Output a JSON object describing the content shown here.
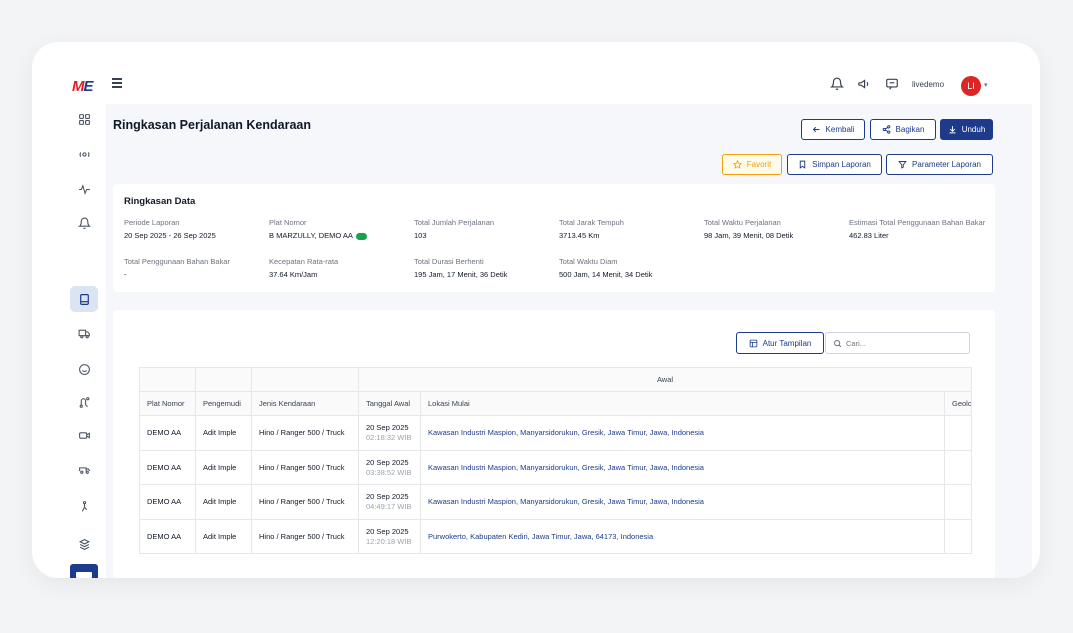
{
  "app": {
    "logo_m": "M",
    "logo_e": "E",
    "username": "livedemo",
    "avatar_initials": "LI"
  },
  "icons": {
    "top": [
      "bell-icon",
      "megaphone-icon",
      "chat-icon"
    ],
    "sidebar": [
      "dashboard-icon",
      "tracking-icon",
      "activity-icon",
      "notification-icon",
      "report-icon",
      "vehicle-icon",
      "driver-icon",
      "route-icon",
      "camera-icon",
      "fleet-icon",
      "maintenance-icon",
      "inventory-icon"
    ]
  },
  "page": {
    "title": "Ringkasan Perjalanan Kendaraan",
    "buttons": {
      "back": "Kembali",
      "share": "Bagikan",
      "download": "Unduh",
      "favorite": "Favorit",
      "save": "Simpan Laporan",
      "params": "Parameter Laporan"
    }
  },
  "summary": {
    "title": "Ringkasan Data",
    "fields": [
      {
        "label": "Periode Laporan",
        "value": "20 Sep 2025 - 26 Sep 2025"
      },
      {
        "label": "Plat Nomor",
        "value": "B MARZULLY, DEMO AA"
      },
      {
        "label": "Total Jumlah Perjalanan",
        "value": "103"
      },
      {
        "label": "Total Jarak Tempuh",
        "value": "3713.45 Km"
      },
      {
        "label": "Total Waktu Perjalanan",
        "value": "98 Jam, 39 Menit, 08 Detik"
      },
      {
        "label": "Estimasi Total Penggunaan Bahan Bakar",
        "value": "462.83 Liter"
      },
      {
        "label": "Total Penggunaan Bahan Bakar",
        "value": "-"
      },
      {
        "label": "Kecepatan Rata-rata",
        "value": "37.64 Km/Jam"
      },
      {
        "label": "Total Durasi Berhenti",
        "value": "195 Jam, 17 Menit, 36 Detik"
      },
      {
        "label": "Total Waktu Diam",
        "value": "500 Jam, 14 Menit, 34 Detik"
      }
    ],
    "badge_color": "#16a34a"
  },
  "table": {
    "view_button": "Atur Tampilan",
    "search_placeholder": "Cari...",
    "group_header": "Awal",
    "columns": [
      "Plat Nomor",
      "Pengemudi",
      "Jenis Kendaraan",
      "Tanggal Awal",
      "Lokasi Mulai",
      "Geolo"
    ],
    "rows": [
      {
        "plate": "DEMO AA",
        "driver": "Adit Imple",
        "type": "Hino / Ranger 500 / Truck",
        "date": "20 Sep 2025",
        "time": "02:18:32 WIB",
        "location": "Kawasan Industri Maspion, Manyarsidorukun, Gresik, Jawa Timur, Jawa, Indonesia"
      },
      {
        "plate": "DEMO AA",
        "driver": "Adit Imple",
        "type": "Hino / Ranger 500 / Truck",
        "date": "20 Sep 2025",
        "time": "03:38:52 WIB",
        "location": "Kawasan Industri Maspion, Manyarsidorukun, Gresik, Jawa Timur, Jawa, Indonesia"
      },
      {
        "plate": "DEMO AA",
        "driver": "Adit Imple",
        "type": "Hino / Ranger 500 / Truck",
        "date": "20 Sep 2025",
        "time": "04:49:17 WIB",
        "location": "Kawasan Industri Maspion, Manyarsidorukun, Gresik, Jawa Timur, Jawa, Indonesia"
      },
      {
        "plate": "DEMO AA",
        "driver": "Adit Imple",
        "type": "Hino / Ranger 500 / Truck",
        "date": "20 Sep 2025",
        "time": "12:20:18 WIB",
        "location": "Purwokerto, Kabupaten Kediri, Jawa Timur, Jawa, 64173, Indonesia"
      }
    ]
  },
  "colors": {
    "brand": "#1e3a8a",
    "accent_red": "#e11d2a",
    "favorite": "#f59e0b"
  }
}
